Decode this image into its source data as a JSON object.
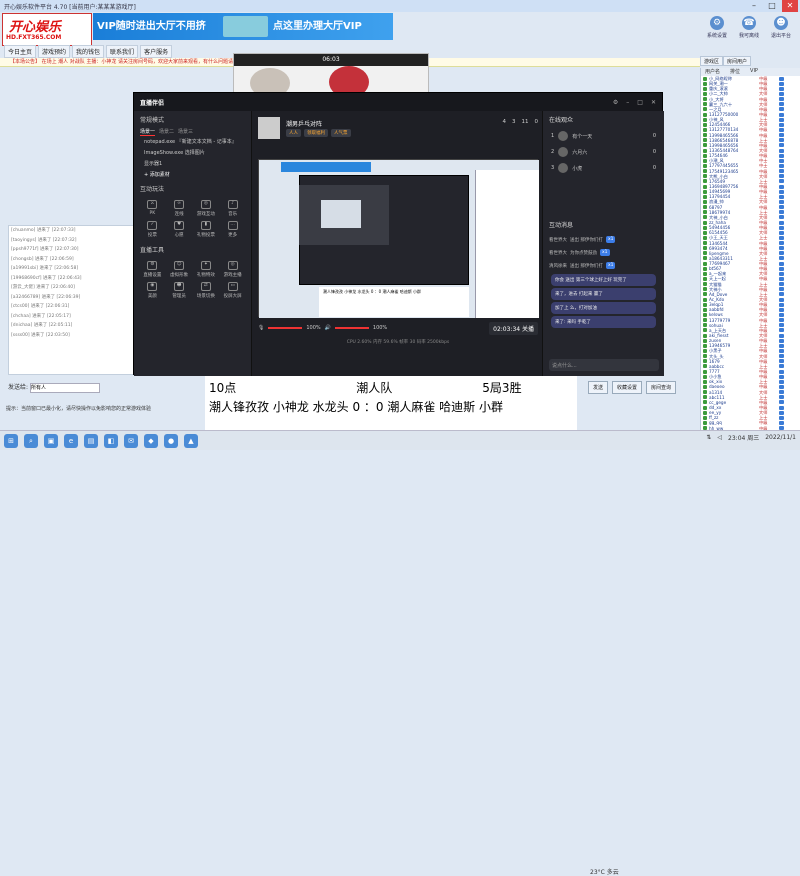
{
  "window": {
    "title": "开心娱乐软件平台 4.70 [当前用户:某某某游戏厅]"
  },
  "logo": {
    "line1": "开心娱乐",
    "line2": "HD.FXT365.COM"
  },
  "banner": {
    "text1": "VIP随时进出大厅不用挤",
    "text2": "点这里办理大厅VIP"
  },
  "menubar": {
    "items": [
      "今日主页",
      "游戏预约",
      "我的钱包",
      "联系我们",
      "客户服务"
    ]
  },
  "right_tools": [
    {
      "label": "系统设置",
      "icon": "gear-icon"
    },
    {
      "label": "我可离线",
      "icon": "phone-icon"
    },
    {
      "label": "退出平台",
      "icon": "user-icon"
    }
  ],
  "notice": "【本场公告】 在场上 潮人 对战队 主播：小神龙 请关注房间号码，欢迎大家前来观看，有什么问题请联系客服",
  "left_chat": [
    "[chuanmo] 进来了 [22:07:33]",
    "[taoyingys] 进来了 [22:07:32]",
    "[ppsh9771f] 进来了 [22:07:30]",
    "[chongsb] 进来了 [22:06:59]",
    "[a19991sbi] 进来了 [22:06:58]",
    "[19968690cf] 进来了 [22:06:43]",
    "[游云_大佬] 进来了 [22:06:40]",
    "[a32466789] 进来了 [22:06:39]",
    "[ctcs00] 进来了 [22:06:31]",
    "[chchaa] 进来了 [22:05:17]",
    "[dnichaa] 进来了 [22:05:11]",
    "[ssss00] 进来了 [22:03:50]"
  ],
  "room_tabs": [
    "游戏区",
    "房间用户"
  ],
  "userlist": {
    "headers": [
      "用户名",
      "排位",
      "VIP"
    ],
    "users": [
      {
        "name": "小_网络昵称",
        "rank": "中级"
      },
      {
        "name": "网关_潮一",
        "rank": "中级"
      },
      {
        "name": "重庆_滚滚",
        "rank": "中级"
      },
      {
        "name": "小二_大帅",
        "rank": "大师"
      },
      {
        "name": "小_大将",
        "rank": "中级"
      },
      {
        "name": "赢三_九六十",
        "rank": "大师"
      },
      {
        "name": "一之月",
        "rank": "中级"
      },
      {
        "name": "13127750000",
        "rank": "中级"
      },
      {
        "name": "小神_风",
        "rank": "上士"
      },
      {
        "name": "12454466",
        "rank": "大师"
      },
      {
        "name": "13127770134",
        "rank": "中级"
      },
      {
        "name": "13998465566",
        "rank": "中级"
      },
      {
        "name": "13866546878",
        "rank": "上士"
      },
      {
        "name": "13998465656",
        "rank": "中级"
      },
      {
        "name": "13365448764",
        "rank": "大师"
      },
      {
        "name": "1754646",
        "rank": "中级"
      },
      {
        "name": "小潮_风",
        "rank": "中士"
      },
      {
        "name": "17797445655",
        "rank": "中士"
      },
      {
        "name": "17549123465",
        "rank": "中级"
      },
      {
        "name": "大熊_小白",
        "rank": "大师"
      },
      {
        "name": "176549",
        "rank": "上士"
      },
      {
        "name": "13694897756",
        "rank": "中级"
      },
      {
        "name": "14945699",
        "rank": "中级"
      },
      {
        "name": "13794454",
        "rank": "上士"
      },
      {
        "name": "浪漫_帅",
        "rank": "大师"
      },
      {
        "name": "68797",
        "rank": "中级"
      },
      {
        "name": "18679974",
        "rank": "上士"
      },
      {
        "name": "大神_小白",
        "rank": "大师"
      },
      {
        "name": "zz_haha",
        "rank": "中级"
      },
      {
        "name": "54944456",
        "rank": "中级"
      },
      {
        "name": "6154456",
        "rank": "大师"
      },
      {
        "name": "小王_天王",
        "rank": "上士"
      },
      {
        "name": "1346544",
        "rank": "中级"
      },
      {
        "name": "6993474",
        "rank": "中级"
      },
      {
        "name": "lipengme",
        "rank": "大师"
      },
      {
        "name": "a18643311",
        "rank": "上士"
      },
      {
        "name": "77699467",
        "rank": "中级"
      },
      {
        "name": "bt567",
        "rank": "中级"
      },
      {
        "name": "a_一起来",
        "rank": "大师"
      },
      {
        "name": "天上一起",
        "rank": "中级"
      },
      {
        "name": "大猫猫",
        "rank": "上士"
      },
      {
        "name": "大神小",
        "rank": "中级"
      },
      {
        "name": "Ad_Dove",
        "rank": "上士"
      },
      {
        "name": "Ac_Kdo",
        "rank": "大师"
      },
      {
        "name": "3elqp1",
        "rank": "中级"
      },
      {
        "name": "aabbfd",
        "rank": "中级"
      },
      {
        "name": "kelsws",
        "rank": "大师"
      },
      {
        "name": "13779779",
        "rank": "中级"
      },
      {
        "name": "sohuai",
        "rank": "上士"
      },
      {
        "name": "a_上天台",
        "rank": "中级"
      },
      {
        "name": "aki_fiesst",
        "rank": "大师"
      },
      {
        "name": "zusen",
        "rank": "中级"
      },
      {
        "name": "13946579",
        "rank": "上士"
      },
      {
        "name": "小黑子",
        "rank": "中级"
      },
      {
        "name": "大头_头",
        "rank": "大师"
      },
      {
        "name": "1679",
        "rank": "中级"
      },
      {
        "name": "aabbcc",
        "rank": "上士"
      },
      {
        "name": "7777",
        "rank": "中级"
      },
      {
        "name": "小小鱼",
        "rank": "中级"
      },
      {
        "name": "ok_xix",
        "rank": "上士"
      },
      {
        "name": "daeoeo",
        "rank": "中级"
      },
      {
        "name": "a1314",
        "rank": "大师"
      },
      {
        "name": "abc111",
        "rank": "上士"
      },
      {
        "name": "cc_gege",
        "rank": "中级"
      },
      {
        "name": "dd_xx",
        "rank": "中级"
      },
      {
        "name": "ee_yy",
        "rank": "大师"
      },
      {
        "name": "ff_zz",
        "rank": "上士"
      },
      {
        "name": "gg_qq",
        "rank": "中级"
      },
      {
        "name": "hh_ww",
        "rank": "中级"
      },
      {
        "name": "ii_ee",
        "rank": "大师"
      }
    ]
  },
  "video_back": {
    "time": "06:03"
  },
  "obs": {
    "app_name": "直播伴侣",
    "scene_mode": "常规模式",
    "scene_tabs": [
      "场景一",
      "场景二",
      "场景三"
    ],
    "sources": [
      "notepad.exe 『新建文本文档 - 记事本』",
      "ImageShow.exe 选择图片",
      "显示器1"
    ],
    "add_source": "+ 添加素材",
    "interact_title": "互动玩法",
    "interact_items": [
      "PK",
      "连线",
      "游戏互动",
      "音乐",
      "投票",
      "心愿",
      "礼物投票",
      "更多"
    ],
    "tools_title": "直播工具",
    "tools_items": [
      "直播设置",
      "虚拟形象",
      "礼物特效",
      "游戏主播",
      "美颜",
      "管理员",
      "场景切换",
      "投屏大屏"
    ],
    "stream_title": "潮男乒乓对阵",
    "stream_tags": [
      "人人",
      "领取福利",
      "人气票"
    ],
    "header_stats": [
      "4",
      "3",
      "11",
      "0"
    ],
    "volume_mic": "100%",
    "volume_speaker": "100%",
    "timer": "02:03:34 关播",
    "stats": "CPU 2.60%  内存 59.6%  帧率 30  码率 2500kbps",
    "audience_title": "在线观众",
    "audience": [
      {
        "rank": "1",
        "name": "有个一天",
        "score": "0"
      },
      {
        "rank": "2",
        "name": "六月六",
        "score": "0"
      },
      {
        "rank": "3",
        "name": "小虎",
        "score": "0"
      }
    ],
    "messages_title": "互动消息",
    "messages": [
      {
        "user": "看世界大",
        "text": "送出 那伊你们打",
        "gift": "x1"
      },
      {
        "user": "看世界大",
        "text": "为你点赞鼓劲",
        "gift": "x1"
      },
      {
        "user": "清风徐来",
        "text": "送出 那伊你们打",
        "gift": "x1"
      }
    ],
    "bubbles": [
      "你会 送出 第三个球上好上好 玩完了",
      "来了，进去 打起来 赢了",
      "加了上 么，打对加油",
      "来了: 来吗 手乾了"
    ],
    "chat_placeholder": "说点什么..."
  },
  "caption": {
    "line1": [
      "10点",
      "潮人队",
      "5局3胜"
    ],
    "line2": "潮人锋孜孜  小神龙  水龙头 0 ：0  潮人麻雀 哈迪斯 小群"
  },
  "bottom": {
    "label": "发送给:",
    "input_value": "所有人",
    "tip": "提示：当前窗口已最小化，请尽快操作以免影响您的正常游戏体验"
  },
  "right_buttons": [
    "发送",
    "收藏设置",
    "房间查询"
  ],
  "taskbar": {
    "weather": "23°C 多云",
    "time": "23:04 周三",
    "date": "2022/11/1"
  }
}
